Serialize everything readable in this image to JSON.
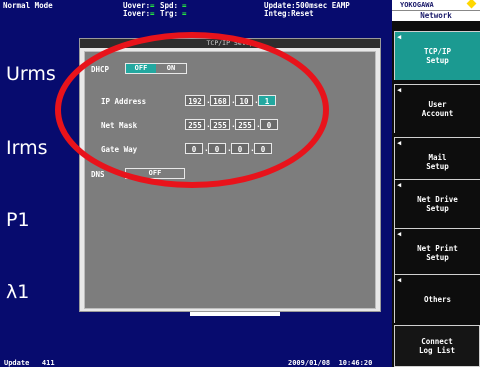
{
  "status": {
    "mode": "Normal Mode",
    "uover_label": "Uover:",
    "uover_value": "=",
    "iover_label": "Iover:",
    "iover_value": "=",
    "spd_label": "Spd:",
    "spd_value": "=",
    "trg_label": "Trg:",
    "trg_value": "=",
    "update": "Update:500msec EAMP",
    "integ": "Integ:Reset"
  },
  "measurements": [
    "Urms",
    "Irms",
    "P1",
    "λ1"
  ],
  "bottom": {
    "left": "Update   411",
    "right": "2009/01/08  10:46:20"
  },
  "dialog": {
    "title": "TCP/IP Setup",
    "dhcp_label": "DHCP",
    "dhcp_off": "OFF",
    "dhcp_on": "ON",
    "ip_label": "IP Address",
    "ip_octets": [
      "192",
      "168",
      "10",
      "1"
    ],
    "mask_label": "Net Mask",
    "mask_octets": [
      "255",
      "255",
      "255",
      "0"
    ],
    "gateway_label": "Gate Way",
    "gateway_octets": [
      "0",
      "0",
      "0",
      "0"
    ],
    "dns_label": "DNS",
    "dns_value": "OFF"
  },
  "panel": {
    "brand": "YOKOGAWA",
    "title": "Network",
    "softkeys": [
      {
        "line1": "TCP/IP",
        "line2": "Setup",
        "active": true
      },
      {
        "line1": "User",
        "line2": "Account",
        "active": false
      },
      {
        "line1": "Mail",
        "line2": "Setup",
        "active": false
      },
      {
        "line1": "Net Drive",
        "line2": "Setup",
        "active": false
      },
      {
        "line1": "Net Print",
        "line2": "Setup",
        "active": false
      },
      {
        "line1": "Others",
        "line2": "",
        "active": false
      },
      {
        "line1": "Connect",
        "line2": "Log List",
        "active": false
      }
    ]
  },
  "colors": {
    "screen_bg": "#070b6e",
    "highlight": "#23a8a0",
    "annotation": "#e8131b",
    "status_green": "#29ff3a"
  }
}
